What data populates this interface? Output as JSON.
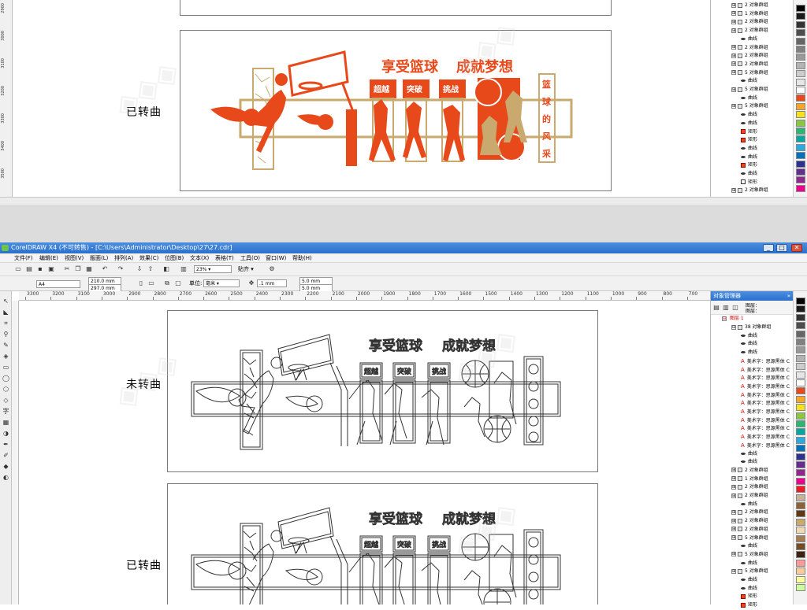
{
  "app": {
    "title": "CorelDRAW X4 (不可转售) - [C:\\Users\\Administrator\\Desktop\\27\\27.cdr]"
  },
  "menu": [
    "文件(F)",
    "编辑(E)",
    "视图(V)",
    "版面(L)",
    "排列(A)",
    "效果(C)",
    "位图(B)",
    "文本(X)",
    "表格(T)",
    "工具(O)",
    "窗口(W)",
    "帮助(H)"
  ],
  "toolbar": {
    "zoom": "23%",
    "snap": "贴齐"
  },
  "property_bar": {
    "paper": "A4",
    "width": "210.0 mm",
    "height": "297.0 mm",
    "units_label": "单位:",
    "units": "毫米",
    "nudge": ".1 mm",
    "dup_x": "5.0 mm",
    "dup_y": "5.0 mm"
  },
  "ruler": {
    "h_ticks": [
      "3300",
      "3200",
      "3100",
      "3000",
      "2900",
      "2800",
      "2700",
      "2600",
      "2500",
      "2400",
      "2300",
      "2200",
      "2100",
      "2000",
      "1900",
      "1800",
      "1700",
      "1600",
      "1500",
      "1400",
      "1300",
      "1200",
      "1100",
      "1000",
      "900",
      "800",
      "700"
    ],
    "v_ticks_top": [
      "2900",
      "3000",
      "3100",
      "3200",
      "3300",
      "3400",
      "3500"
    ]
  },
  "design": {
    "slogan_left": "享受篮球",
    "slogan_right": "成就梦想",
    "tags": [
      "超越",
      "突破",
      "挑战"
    ],
    "vertical_text": [
      "篮",
      "球",
      "的",
      "风",
      "采"
    ],
    "accent_color": "#e8491b",
    "gold_color": "#c9a96e"
  },
  "captions": {
    "top": "已转曲",
    "middle": "未转曲",
    "bottom": "已转曲"
  },
  "object_manager": {
    "title": "对象管理器",
    "layer_label": "图层：",
    "layer_name": "图层 1",
    "top_rows": [
      {
        "expander": "⊞",
        "icon": "group",
        "label": "2 对象群组"
      },
      {
        "expander": "⊞",
        "icon": "group",
        "label": "1 对象群组"
      },
      {
        "expander": "⊞",
        "icon": "group",
        "label": "2 对象群组"
      },
      {
        "expander": "⊞",
        "icon": "group",
        "label": "2 对象群组"
      },
      {
        "expander": "",
        "icon": "curve",
        "label": "曲线"
      },
      {
        "expander": "⊞",
        "icon": "group",
        "label": "2 对象群组"
      },
      {
        "expander": "⊞",
        "icon": "group",
        "label": "2 对象群组"
      },
      {
        "expander": "⊞",
        "icon": "group",
        "label": "2 对象群组"
      },
      {
        "expander": "⊞",
        "icon": "group",
        "label": "5 对象群组"
      },
      {
        "expander": "",
        "icon": "curve",
        "label": "曲线"
      },
      {
        "expander": "⊞",
        "icon": "group",
        "label": "5 对象群组"
      },
      {
        "expander": "",
        "icon": "curve",
        "label": "曲线"
      },
      {
        "expander": "⊞",
        "icon": "group",
        "label": "5 对象群组"
      },
      {
        "expander": "",
        "icon": "curve",
        "label": "曲线"
      },
      {
        "expander": "",
        "icon": "curve",
        "label": "曲线"
      },
      {
        "expander": "",
        "icon": "rect",
        "label": "矩形"
      },
      {
        "expander": "",
        "icon": "rect",
        "label": "矩形"
      },
      {
        "expander": "",
        "icon": "curve",
        "label": "曲线"
      },
      {
        "expander": "",
        "icon": "curve",
        "label": "曲线"
      },
      {
        "expander": "",
        "icon": "rect",
        "label": "矩形"
      },
      {
        "expander": "",
        "icon": "curve",
        "label": "曲线"
      },
      {
        "expander": "",
        "icon": "rect-empty",
        "label": "矩形"
      },
      {
        "expander": "⊞",
        "icon": "group",
        "label": "2 对象群组"
      }
    ],
    "rows": [
      {
        "expander": "⊟",
        "icon": "group",
        "label": "38 对象群组"
      },
      {
        "expander": "",
        "icon": "curve",
        "label": "曲线"
      },
      {
        "expander": "",
        "icon": "curve",
        "label": "曲线"
      },
      {
        "expander": "",
        "icon": "curve",
        "label": "曲线"
      },
      {
        "expander": "",
        "icon": "text",
        "label": "美术字：思源黑体 C"
      },
      {
        "expander": "",
        "icon": "text",
        "label": "美术字：思源黑体 C"
      },
      {
        "expander": "",
        "icon": "text",
        "label": "美术字：思源黑体 C"
      },
      {
        "expander": "",
        "icon": "text",
        "label": "美术字：思源黑体 C"
      },
      {
        "expander": "",
        "icon": "text",
        "label": "美术字：思源黑体 C"
      },
      {
        "expander": "",
        "icon": "text",
        "label": "美术字：思源黑体 C"
      },
      {
        "expander": "",
        "icon": "text",
        "label": "美术字：思源黑体 C"
      },
      {
        "expander": "",
        "icon": "text",
        "label": "美术字：思源黑体 C"
      },
      {
        "expander": "",
        "icon": "text",
        "label": "美术字：思源黑体 C"
      },
      {
        "expander": "",
        "icon": "text",
        "label": "美术字：思源黑体 C"
      },
      {
        "expander": "",
        "icon": "text",
        "label": "美术字：思源黑体 C"
      },
      {
        "expander": "",
        "icon": "curve",
        "label": "曲线"
      },
      {
        "expander": "",
        "icon": "curve",
        "label": "曲线"
      },
      {
        "expander": "⊞",
        "icon": "group",
        "label": "2 对象群组"
      },
      {
        "expander": "⊞",
        "icon": "group",
        "label": "1 对象群组"
      },
      {
        "expander": "⊞",
        "icon": "group",
        "label": "2 对象群组"
      },
      {
        "expander": "⊞",
        "icon": "group",
        "label": "2 对象群组"
      },
      {
        "expander": "",
        "icon": "curve",
        "label": "曲线"
      },
      {
        "expander": "⊞",
        "icon": "group",
        "label": "2 对象群组"
      },
      {
        "expander": "⊞",
        "icon": "group",
        "label": "2 对象群组"
      },
      {
        "expander": "⊞",
        "icon": "group",
        "label": "2 对象群组"
      },
      {
        "expander": "⊞",
        "icon": "group",
        "label": "5 对象群组"
      },
      {
        "expander": "",
        "icon": "curve",
        "label": "曲线"
      },
      {
        "expander": "⊞",
        "icon": "group",
        "label": "5 对象群组"
      },
      {
        "expander": "",
        "icon": "curve",
        "label": "曲线"
      },
      {
        "expander": "⊞",
        "icon": "group",
        "label": "5 对象群组"
      },
      {
        "expander": "",
        "icon": "curve",
        "label": "曲线"
      },
      {
        "expander": "",
        "icon": "curve",
        "label": "曲线"
      },
      {
        "expander": "",
        "icon": "rect",
        "label": "矩形"
      },
      {
        "expander": "",
        "icon": "rect",
        "label": "矩形"
      }
    ]
  },
  "palette": [
    "#000000",
    "#1a1a1a",
    "#333333",
    "#4d4d4d",
    "#666666",
    "#808080",
    "#999999",
    "#b3b3b3",
    "#cccccc",
    "#e6e6e6",
    "#ffffff",
    "#e8491b",
    "#f6a623",
    "#f7e11a",
    "#8dc63f",
    "#2bb673",
    "#00a99d",
    "#29abe2",
    "#0072bc",
    "#2e3192",
    "#662d91",
    "#92278f",
    "#ec008c",
    "#ed1c24",
    "#c7b299",
    "#8c6239",
    "#603813",
    "#c9a96e",
    "#f0d9b5",
    "#a67c52",
    "#754c24",
    "#3c2415",
    "#ff9999",
    "#ffcc99",
    "#ffff99",
    "#ccff99"
  ]
}
